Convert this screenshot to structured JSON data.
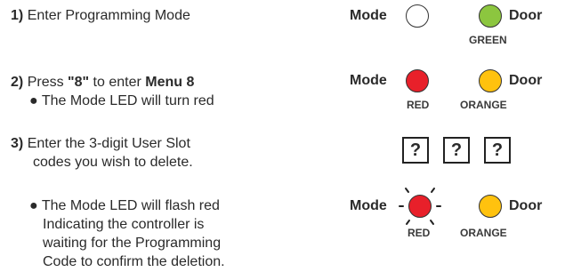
{
  "steps": [
    {
      "number": "1)",
      "text": "Enter Programming Mode"
    },
    {
      "number": "2)",
      "pre": "Press ",
      "key": "\"8\"",
      "mid": " to enter ",
      "menu": "Menu 8",
      "bullet": "● The Mode LED will turn red"
    },
    {
      "number": "3)",
      "line1": "Enter the 3-digit User Slot",
      "line2": "codes you wish to delete."
    },
    {
      "lines": [
        "● The Mode LED will flash red",
        "Indicating the controller is",
        "waiting for the Programming",
        "Code to confirm the deletion."
      ]
    }
  ],
  "panels": {
    "row1": {
      "mode": "Mode",
      "door": "Door",
      "door_caption": "GREEN",
      "mode_color": "#ffffff",
      "door_color": "#8cc63f"
    },
    "row2": {
      "mode": "Mode",
      "door": "Door",
      "mode_caption": "RED",
      "door_caption": "ORANGE",
      "mode_color": "#e8202a",
      "door_color": "#ffc20e"
    },
    "row3": {
      "boxes": [
        "?",
        "?",
        "?"
      ]
    },
    "row4": {
      "mode": "Mode",
      "door": "Door",
      "mode_caption": "RED",
      "door_caption": "ORANGE",
      "mode_color": "#e8202a",
      "door_color": "#ffc20e",
      "mode_state": "flashing"
    }
  }
}
